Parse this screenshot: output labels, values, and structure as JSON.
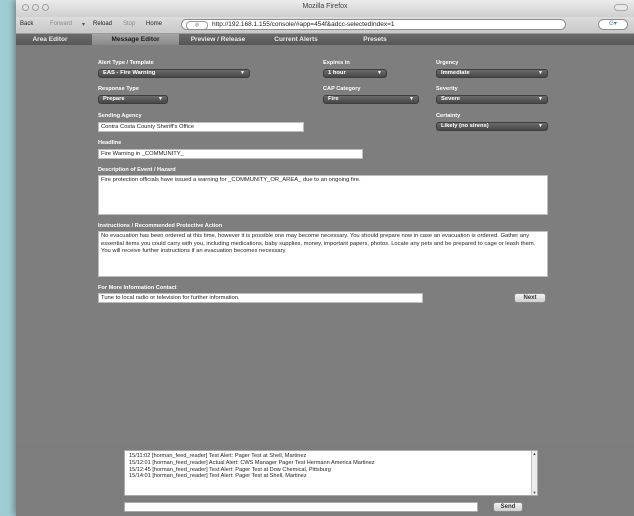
{
  "window": {
    "title": "Mozilla Firefox"
  },
  "nav": {
    "back": "Back",
    "forward": "Forward",
    "reload": "Reload",
    "stop": "Stop",
    "home": "Home",
    "url": "http://192.168.1.155/console/#app=454f&adcc-selectedIndex=1",
    "search_placeholder": "G▾"
  },
  "tabs": [
    {
      "label": "Area Editor",
      "active": false
    },
    {
      "label": "Message Editor",
      "active": true
    },
    {
      "label": "Preview / Release",
      "active": false
    },
    {
      "label": "Current Alerts",
      "active": false
    },
    {
      "label": "Presets",
      "active": false
    }
  ],
  "form": {
    "alert_type": {
      "label": "Alert Type / Template",
      "value": "EAS - Fire Warning"
    },
    "expires": {
      "label": "Expires in",
      "value": "1 hour"
    },
    "urgency": {
      "label": "Urgency",
      "value": "Immediate"
    },
    "response_type": {
      "label": "Response Type",
      "value": "Prepare"
    },
    "cap_category": {
      "label": "CAP Category",
      "value": "Fire"
    },
    "severity": {
      "label": "Severity",
      "value": "Severe"
    },
    "sending_agency": {
      "label": "Sending Agency",
      "value": "Contra Costa County Sheriff's Office"
    },
    "certainty": {
      "label": "Certainty",
      "value": "Likely (no sirens)"
    },
    "headline": {
      "label": "Headline",
      "value": "Fire Warning in _COMMUNITY_"
    },
    "description": {
      "label": "Description of Event / Hazard",
      "value": "Fire protection officials have issued a warning for _COMMUNITY_OR_AREA_ due to an ongoing fire."
    },
    "instructions": {
      "label": "Instructions / Recommended Protective Action",
      "value": "No evacuation has been ordered at this time, however it is possible one may become necessary.  You should prepare now in case an evacuation is ordered.  Gather any essential items you could carry with you, including medications, baby supplies, money, important papers, photos.  Locate any pets and be prepared to cage or leash them.  You will receive further instructions if an evacuation becomes necessary."
    },
    "more_info": {
      "label": "For More Information Contact",
      "value": "Tune to local radio or television for further information."
    },
    "next_label": "Next"
  },
  "log": {
    "lines": [
      "15/11:02 [horman_feed_reader]  Test Alert: Pager Test at Shell, Martinez",
      "15/12:01 [horman_feed_reader]  Actual Alert: CWS Manager Pager Test Hermann America Martinez",
      "15/12:45 [horman_feed_reader]  Test Alert: Pager Test at Dow Chemical, Pittsburg",
      "15/14:01 [horman_feed_reader]  Test Alert: Pager Test at Shell, Martinez"
    ],
    "send_label": "Send"
  }
}
